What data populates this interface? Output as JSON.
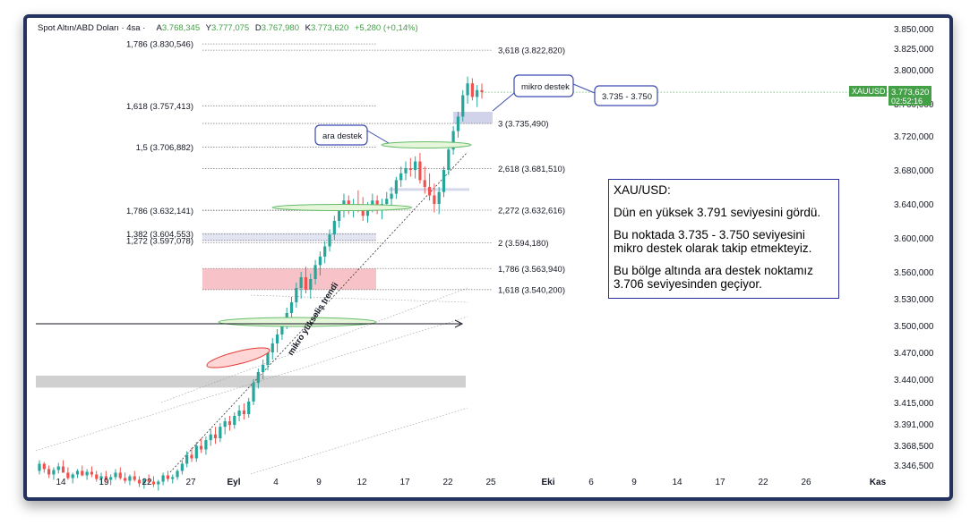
{
  "header": {
    "symbol": "Spot Altın/ABD Doları · 4sa ·",
    "o_label": "A",
    "o_value": "3.768,345",
    "h_label": "Y",
    "h_value": "3.777,075",
    "l_label": "D",
    "l_value": "3.767,980",
    "c_label": "K",
    "c_value": "3.773,620",
    "change": "+5,280 (+0,14%)"
  },
  "price_tag": {
    "symbol": "XAUUSD",
    "price": "3.773,620",
    "countdown": "02:52:16",
    "color": "#43a047"
  },
  "note": {
    "title": "XAU/USD:",
    "p1": "Dün en yüksek 3.791 seviyesini gördü.",
    "p2": "Bu noktada 3.735 - 3.750 seviyesini mikro destek olarak takip etmekteyiz.",
    "p3": "Bu bölge altında ara destek noktamız 3.706 seviyesinden geçiyor."
  },
  "callouts": {
    "mikro_destek": "mikro destek",
    "range": "3.735 - 3.750",
    "ara_destek": "ara destek",
    "trend": "mikro yükseliş trendi"
  },
  "chart_data": {
    "type": "candlestick",
    "x_ticks": [
      "14",
      "19",
      "22",
      "27",
      "Eyl",
      "4",
      "9",
      "12",
      "17",
      "22",
      "25",
      "Eki",
      "6",
      "9",
      "14",
      "17",
      "22",
      "26",
      "Kas"
    ],
    "y_ticks": [
      "3.850,000",
      "3.825,000",
      "3.800,000",
      "3.760,000",
      "3.720,000",
      "3.680,000",
      "3.640,000",
      "3.600,000",
      "3.560,000",
      "3.530,000",
      "3.500,000",
      "3.470,000",
      "3.440,000",
      "3.415,000",
      "3.391,000",
      "3.368,500",
      "3.346,500"
    ],
    "y_tick_values": [
      3850,
      3825,
      3800,
      3760,
      3720,
      3680,
      3640,
      3600,
      3560,
      3530,
      3500,
      3470,
      3440,
      3415,
      3391,
      3368.5,
      3346.5
    ],
    "fib_left": [
      {
        "label": "1,786 (3.830,546)",
        "value": 3830.546
      },
      {
        "label": "1,618 (3.757,413)",
        "value": 3757.413
      },
      {
        "label": "1,5 (3.706,882)",
        "value": 3706.882
      },
      {
        "label": "1,786 (3.632,141)",
        "value": 3632.141
      },
      {
        "label": "1,382 (3.604,553)",
        "value": 3604.553
      },
      {
        "label": "1,272 (3.597,078)",
        "value": 3597.078
      }
    ],
    "fib_right": [
      {
        "label": "3,618 (3.822,820)",
        "value": 3822.82
      },
      {
        "label": "3 (3.735,490)",
        "value": 3735.49
      },
      {
        "label": "2,618 (3.681,510)",
        "value": 3681.51
      },
      {
        "label": "2,272 (3.632,616)",
        "value": 3632.616
      },
      {
        "label": "2 (3.594,180)",
        "value": 3594.18
      },
      {
        "label": "1,786 (3.563,940)",
        "value": 3563.94
      },
      {
        "label": "1,618 (3.540,200)",
        "value": 3540.2
      }
    ],
    "zones": [
      {
        "name": "pink-zone",
        "from": 3540.2,
        "to": 3563.94,
        "color": "#f6b8bf"
      },
      {
        "name": "gray-zone",
        "from": 3431,
        "to": 3444,
        "color": "#c8c8c8"
      },
      {
        "name": "micro-support-zone",
        "from": 3735,
        "to": 3750,
        "color": "#c9cbe8"
      }
    ],
    "up_color": "#26a69a",
    "down_color": "#ef5350",
    "candles_approx": [
      [
        3340,
        3352,
        3336,
        3348
      ],
      [
        3348,
        3350,
        3338,
        3342
      ],
      [
        3342,
        3346,
        3332,
        3336
      ],
      [
        3336,
        3344,
        3330,
        3341
      ],
      [
        3341,
        3349,
        3337,
        3345
      ],
      [
        3345,
        3352,
        3340,
        3338
      ],
      [
        3338,
        3344,
        3330,
        3332
      ],
      [
        3332,
        3338,
        3326,
        3336
      ],
      [
        3336,
        3342,
        3332,
        3340
      ],
      [
        3340,
        3346,
        3334,
        3335
      ],
      [
        3335,
        3342,
        3330,
        3339
      ],
      [
        3339,
        3345,
        3333,
        3336
      ],
      [
        3336,
        3340,
        3328,
        3331
      ],
      [
        3331,
        3338,
        3325,
        3334
      ],
      [
        3334,
        3340,
        3328,
        3330
      ],
      [
        3330,
        3336,
        3324,
        3333
      ],
      [
        3333,
        3342,
        3330,
        3338
      ],
      [
        3338,
        3344,
        3330,
        3332
      ],
      [
        3332,
        3338,
        3326,
        3329
      ],
      [
        3329,
        3336,
        3324,
        3334
      ],
      [
        3334,
        3340,
        3328,
        3330
      ],
      [
        3330,
        3334,
        3322,
        3326
      ],
      [
        3326,
        3332,
        3320,
        3330
      ],
      [
        3330,
        3336,
        3326,
        3328
      ],
      [
        3328,
        3334,
        3322,
        3325
      ],
      [
        3325,
        3330,
        3318,
        3328
      ],
      [
        3328,
        3338,
        3324,
        3335
      ],
      [
        3335,
        3340,
        3328,
        3331
      ],
      [
        3331,
        3336,
        3326,
        3333
      ],
      [
        3333,
        3342,
        3330,
        3340
      ],
      [
        3340,
        3352,
        3336,
        3348
      ],
      [
        3348,
        3362,
        3344,
        3358
      ],
      [
        3358,
        3366,
        3350,
        3354
      ],
      [
        3354,
        3372,
        3350,
        3368
      ],
      [
        3368,
        3376,
        3360,
        3364
      ],
      [
        3364,
        3378,
        3358,
        3374
      ],
      [
        3374,
        3386,
        3368,
        3380
      ],
      [
        3380,
        3388,
        3370,
        3376
      ],
      [
        3376,
        3392,
        3372,
        3388
      ],
      [
        3388,
        3398,
        3380,
        3394
      ],
      [
        3394,
        3400,
        3384,
        3390
      ],
      [
        3390,
        3404,
        3386,
        3400
      ],
      [
        3400,
        3412,
        3394,
        3406
      ],
      [
        3406,
        3414,
        3396,
        3402
      ],
      [
        3402,
        3420,
        3398,
        3416
      ],
      [
        3416,
        3440,
        3412,
        3436
      ],
      [
        3436,
        3452,
        3430,
        3448
      ],
      [
        3448,
        3462,
        3440,
        3456
      ],
      [
        3456,
        3474,
        3450,
        3470
      ],
      [
        3470,
        3486,
        3462,
        3480
      ],
      [
        3480,
        3496,
        3470,
        3490
      ],
      [
        3490,
        3508,
        3484,
        3502
      ],
      [
        3502,
        3520,
        3496,
        3514
      ],
      [
        3514,
        3532,
        3508,
        3526
      ],
      [
        3526,
        3548,
        3520,
        3542
      ],
      [
        3542,
        3560,
        3530,
        3554
      ],
      [
        3554,
        3566,
        3536,
        3540
      ],
      [
        3540,
        3558,
        3530,
        3552
      ],
      [
        3552,
        3574,
        3546,
        3568
      ],
      [
        3568,
        3584,
        3556,
        3578
      ],
      [
        3578,
        3596,
        3570,
        3590
      ],
      [
        3590,
        3610,
        3584,
        3604
      ],
      [
        3604,
        3626,
        3598,
        3620
      ],
      [
        3620,
        3640,
        3612,
        3634
      ],
      [
        3634,
        3652,
        3624,
        3644
      ],
      [
        3644,
        3650,
        3628,
        3632
      ],
      [
        3632,
        3646,
        3624,
        3640
      ],
      [
        3640,
        3656,
        3630,
        3636
      ],
      [
        3636,
        3648,
        3620,
        3626
      ],
      [
        3626,
        3642,
        3618,
        3638
      ],
      [
        3638,
        3652,
        3630,
        3644
      ],
      [
        3644,
        3650,
        3628,
        3632
      ],
      [
        3632,
        3646,
        3622,
        3640
      ],
      [
        3640,
        3654,
        3632,
        3646
      ],
      [
        3646,
        3660,
        3638,
        3652
      ],
      [
        3652,
        3672,
        3646,
        3668
      ],
      [
        3668,
        3684,
        3660,
        3676
      ],
      [
        3676,
        3690,
        3668,
        3682
      ],
      [
        3682,
        3694,
        3672,
        3680
      ],
      [
        3680,
        3696,
        3670,
        3690
      ],
      [
        3690,
        3700,
        3664,
        3668
      ],
      [
        3668,
        3684,
        3652,
        3660
      ],
      [
        3660,
        3676,
        3644,
        3650
      ],
      [
        3650,
        3664,
        3630,
        3640
      ],
      [
        3640,
        3660,
        3628,
        3654
      ],
      [
        3654,
        3684,
        3648,
        3680
      ],
      [
        3680,
        3710,
        3674,
        3704
      ],
      [
        3704,
        3732,
        3698,
        3726
      ],
      [
        3726,
        3750,
        3718,
        3744
      ],
      [
        3744,
        3776,
        3738,
        3770
      ],
      [
        3770,
        3792,
        3760,
        3784
      ],
      [
        3784,
        3790,
        3764,
        3768
      ],
      [
        3768,
        3782,
        3756,
        3776
      ],
      [
        3776,
        3784,
        3766,
        3773.62
      ]
    ]
  }
}
